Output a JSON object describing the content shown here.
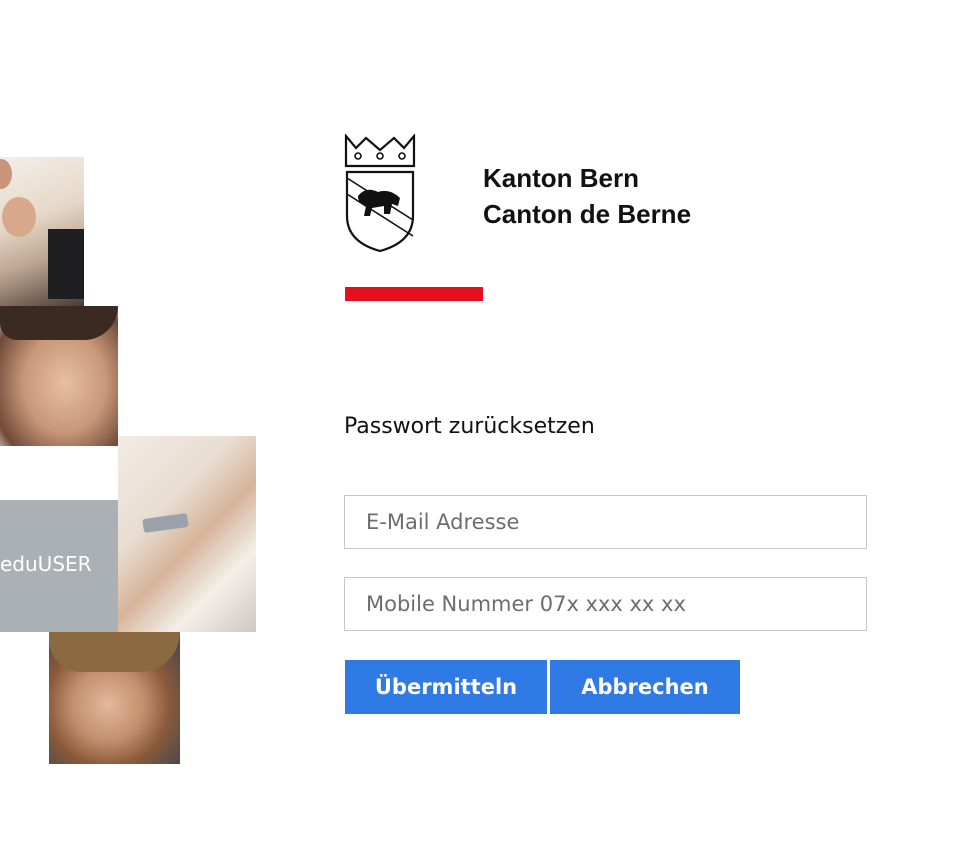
{
  "collage": {
    "label": "eduUSER"
  },
  "logo": {
    "line1": "Kanton Bern",
    "line2": "Canton de Berne"
  },
  "form": {
    "title": "Passwort zurücksetzen",
    "email_placeholder": "E-Mail Adresse",
    "mobile_placeholder": "Mobile Nummer 07x xxx xx xx",
    "submit_label": "Übermitteln",
    "cancel_label": "Abbrechen"
  },
  "colors": {
    "accent": "#2f7ae5",
    "brand_red": "#e5101f",
    "tile_grey": "#aab0b3"
  }
}
